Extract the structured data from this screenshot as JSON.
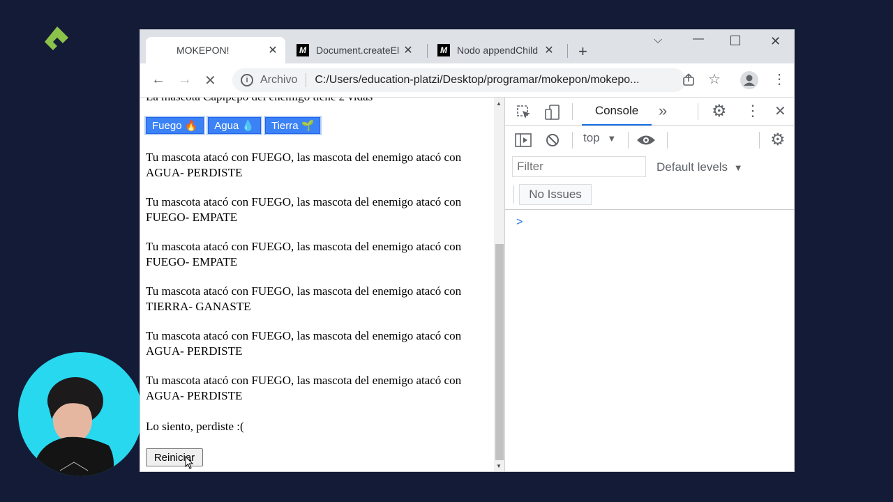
{
  "browser": {
    "tabs": [
      {
        "title": "MOKEPON!",
        "active": true
      },
      {
        "title": "Document.createEl",
        "favicon": "M",
        "active": false
      },
      {
        "title": "Nodo appendChild",
        "favicon": "M",
        "active": false
      }
    ],
    "address": {
      "scheme": "Archivo",
      "url": "C:/Users/education-platzi/Desktop/programar/mokepon/mokepo..."
    }
  },
  "page": {
    "lives_text": "La mascota Capipepo del enemigo tiene 2 vidas",
    "attack_buttons": [
      {
        "label": "Fuego",
        "emoji": "🔥"
      },
      {
        "label": "Agua",
        "emoji": "💧"
      },
      {
        "label": "Tierra",
        "emoji": "🌱"
      }
    ],
    "messages": [
      "Tu mascota atacó con FUEGO, las mascota del enemigo atacó con AGUA- PERDISTE",
      "Tu mascota atacó con FUEGO, las mascota del enemigo atacó con FUEGO- EMPATE",
      "Tu mascota atacó con FUEGO, las mascota del enemigo atacó con FUEGO- EMPATE",
      "Tu mascota atacó con FUEGO, las mascota del enemigo atacó con TIERRA- GANASTE",
      "Tu mascota atacó con FUEGO, las mascota del enemigo atacó con AGUA- PERDISTE",
      "Tu mascota atacó con FUEGO, las mascota del enemigo atacó con AGUA- PERDISTE"
    ],
    "result_text": "Lo siento, perdiste :(",
    "restart_label": "Reiniciar"
  },
  "devtools": {
    "active_tab": "Console",
    "more_tabs": "»",
    "context": "top",
    "filter_placeholder": "Filter",
    "levels": "Default levels",
    "issues": "No Issues",
    "prompt": ">"
  },
  "colors": {
    "background": "#141b36",
    "logo": "#8bc34a",
    "avatar_bg": "#27d8ee",
    "button_blue": "#3b82f6"
  }
}
